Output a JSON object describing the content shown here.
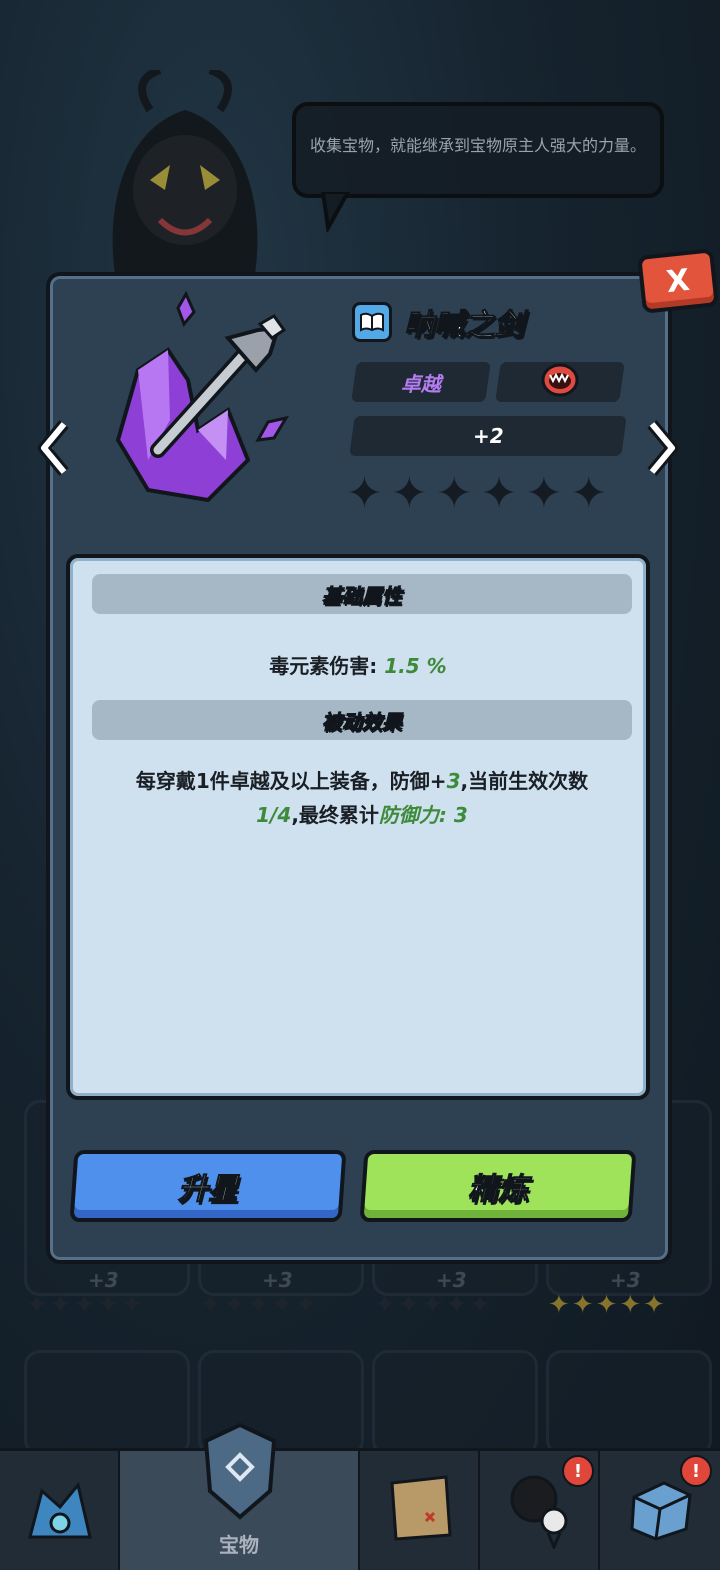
{
  "dialog": {
    "hint_text": "收集宝物，就能继承到宝物原主人强大的力量。",
    "close_label": "X"
  },
  "item": {
    "name": "呐喊之剑",
    "rarity": "卓越",
    "level": "+2",
    "stars_filled": 0,
    "stars_total": 6
  },
  "base_attributes": {
    "header": "基础属性",
    "stat_label": "毒元素伤害:",
    "stat_value": "1.5 %"
  },
  "passive_effect": {
    "header": "被动效果",
    "line1_text": "每穿戴1件卓越及以上装备，防御+",
    "line1_value": "3",
    "line1_suffix": ",当前生效次数",
    "line2_progress": "1/4",
    "line2_text": ",最终累计",
    "line2_value": "防御力: 3"
  },
  "buttons": {
    "upgrade_star": "升星",
    "refine": "精炼"
  },
  "background": {
    "card_levels": [
      "+3",
      "+3",
      "+3",
      "+3"
    ]
  },
  "nav": {
    "active_label": "宝物",
    "badge_text": "!"
  },
  "colors": {
    "accent_green": "#3d8a3a",
    "rarity_purple": "#b47cf0",
    "button_blue": "#4f90ec",
    "button_green": "#9fe35a",
    "close_red": "#e2543b"
  }
}
